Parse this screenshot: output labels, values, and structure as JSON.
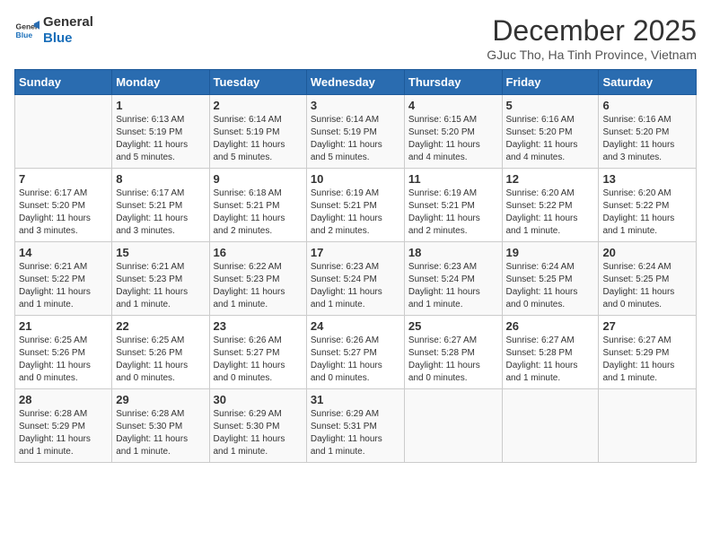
{
  "header": {
    "logo_line1": "General",
    "logo_line2": "Blue",
    "title": "December 2025",
    "subtitle": "GJuc Tho, Ha Tinh Province, Vietnam"
  },
  "columns": [
    "Sunday",
    "Monday",
    "Tuesday",
    "Wednesday",
    "Thursday",
    "Friday",
    "Saturday"
  ],
  "weeks": [
    [
      {
        "day": "",
        "info": ""
      },
      {
        "day": "1",
        "info": "Sunrise: 6:13 AM\nSunset: 5:19 PM\nDaylight: 11 hours\nand 5 minutes."
      },
      {
        "day": "2",
        "info": "Sunrise: 6:14 AM\nSunset: 5:19 PM\nDaylight: 11 hours\nand 5 minutes."
      },
      {
        "day": "3",
        "info": "Sunrise: 6:14 AM\nSunset: 5:19 PM\nDaylight: 11 hours\nand 5 minutes."
      },
      {
        "day": "4",
        "info": "Sunrise: 6:15 AM\nSunset: 5:20 PM\nDaylight: 11 hours\nand 4 minutes."
      },
      {
        "day": "5",
        "info": "Sunrise: 6:16 AM\nSunset: 5:20 PM\nDaylight: 11 hours\nand 4 minutes."
      },
      {
        "day": "6",
        "info": "Sunrise: 6:16 AM\nSunset: 5:20 PM\nDaylight: 11 hours\nand 3 minutes."
      }
    ],
    [
      {
        "day": "7",
        "info": "Sunrise: 6:17 AM\nSunset: 5:20 PM\nDaylight: 11 hours\nand 3 minutes."
      },
      {
        "day": "8",
        "info": "Sunrise: 6:17 AM\nSunset: 5:21 PM\nDaylight: 11 hours\nand 3 minutes."
      },
      {
        "day": "9",
        "info": "Sunrise: 6:18 AM\nSunset: 5:21 PM\nDaylight: 11 hours\nand 2 minutes."
      },
      {
        "day": "10",
        "info": "Sunrise: 6:19 AM\nSunset: 5:21 PM\nDaylight: 11 hours\nand 2 minutes."
      },
      {
        "day": "11",
        "info": "Sunrise: 6:19 AM\nSunset: 5:21 PM\nDaylight: 11 hours\nand 2 minutes."
      },
      {
        "day": "12",
        "info": "Sunrise: 6:20 AM\nSunset: 5:22 PM\nDaylight: 11 hours\nand 1 minute."
      },
      {
        "day": "13",
        "info": "Sunrise: 6:20 AM\nSunset: 5:22 PM\nDaylight: 11 hours\nand 1 minute."
      }
    ],
    [
      {
        "day": "14",
        "info": "Sunrise: 6:21 AM\nSunset: 5:22 PM\nDaylight: 11 hours\nand 1 minute."
      },
      {
        "day": "15",
        "info": "Sunrise: 6:21 AM\nSunset: 5:23 PM\nDaylight: 11 hours\nand 1 minute."
      },
      {
        "day": "16",
        "info": "Sunrise: 6:22 AM\nSunset: 5:23 PM\nDaylight: 11 hours\nand 1 minute."
      },
      {
        "day": "17",
        "info": "Sunrise: 6:23 AM\nSunset: 5:24 PM\nDaylight: 11 hours\nand 1 minute."
      },
      {
        "day": "18",
        "info": "Sunrise: 6:23 AM\nSunset: 5:24 PM\nDaylight: 11 hours\nand 1 minute."
      },
      {
        "day": "19",
        "info": "Sunrise: 6:24 AM\nSunset: 5:25 PM\nDaylight: 11 hours\nand 0 minutes."
      },
      {
        "day": "20",
        "info": "Sunrise: 6:24 AM\nSunset: 5:25 PM\nDaylight: 11 hours\nand 0 minutes."
      }
    ],
    [
      {
        "day": "21",
        "info": "Sunrise: 6:25 AM\nSunset: 5:26 PM\nDaylight: 11 hours\nand 0 minutes."
      },
      {
        "day": "22",
        "info": "Sunrise: 6:25 AM\nSunset: 5:26 PM\nDaylight: 11 hours\nand 0 minutes."
      },
      {
        "day": "23",
        "info": "Sunrise: 6:26 AM\nSunset: 5:27 PM\nDaylight: 11 hours\nand 0 minutes."
      },
      {
        "day": "24",
        "info": "Sunrise: 6:26 AM\nSunset: 5:27 PM\nDaylight: 11 hours\nand 0 minutes."
      },
      {
        "day": "25",
        "info": "Sunrise: 6:27 AM\nSunset: 5:28 PM\nDaylight: 11 hours\nand 0 minutes."
      },
      {
        "day": "26",
        "info": "Sunrise: 6:27 AM\nSunset: 5:28 PM\nDaylight: 11 hours\nand 1 minute."
      },
      {
        "day": "27",
        "info": "Sunrise: 6:27 AM\nSunset: 5:29 PM\nDaylight: 11 hours\nand 1 minute."
      }
    ],
    [
      {
        "day": "28",
        "info": "Sunrise: 6:28 AM\nSunset: 5:29 PM\nDaylight: 11 hours\nand 1 minute."
      },
      {
        "day": "29",
        "info": "Sunrise: 6:28 AM\nSunset: 5:30 PM\nDaylight: 11 hours\nand 1 minute."
      },
      {
        "day": "30",
        "info": "Sunrise: 6:29 AM\nSunset: 5:30 PM\nDaylight: 11 hours\nand 1 minute."
      },
      {
        "day": "31",
        "info": "Sunrise: 6:29 AM\nSunset: 5:31 PM\nDaylight: 11 hours\nand 1 minute."
      },
      {
        "day": "",
        "info": ""
      },
      {
        "day": "",
        "info": ""
      },
      {
        "day": "",
        "info": ""
      }
    ]
  ]
}
